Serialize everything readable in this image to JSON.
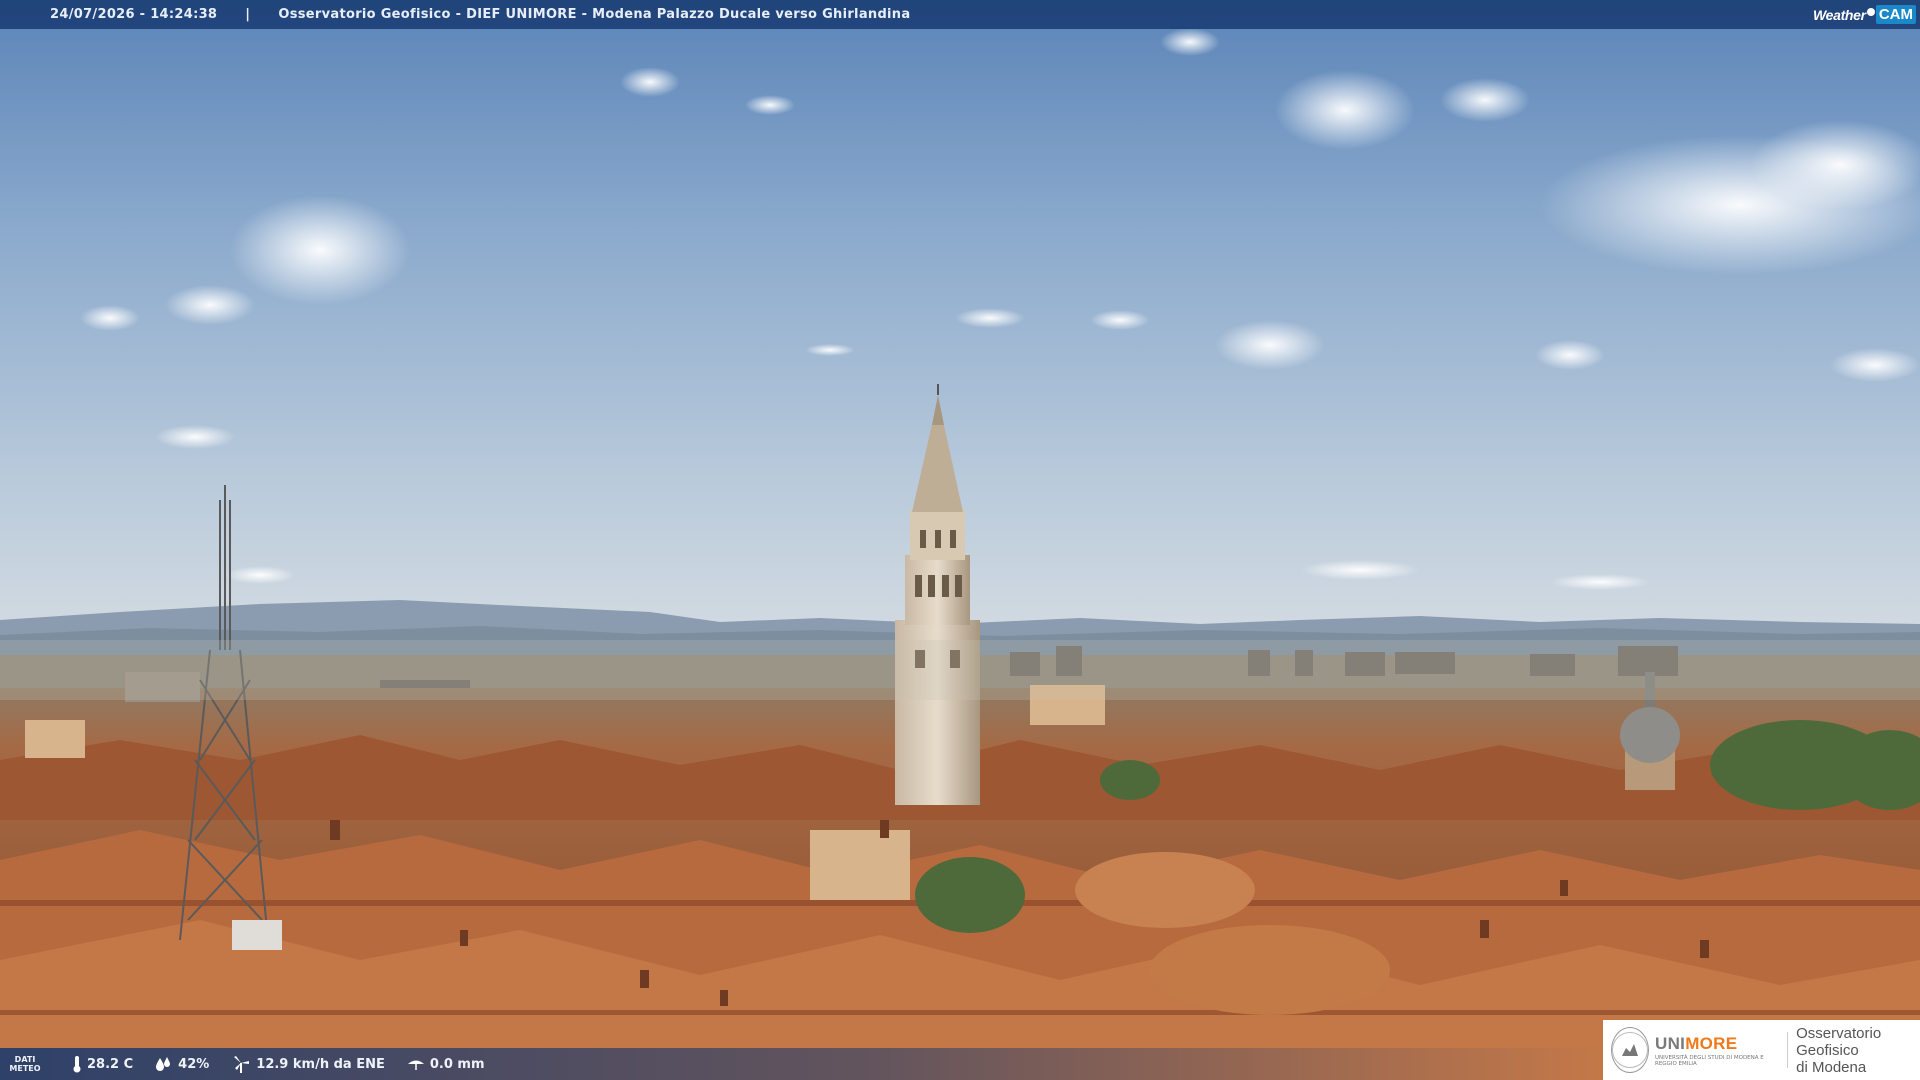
{
  "header": {
    "datetime": "24/07/2026 - 14:24:38",
    "separator": "|",
    "caption": "Osservatorio Geofisico - DIEF UNIMORE - Modena Palazzo Ducale verso Ghirlandina",
    "brand_weather": "Weather",
    "brand_cam": "CAM"
  },
  "weather": {
    "label": "DATI METEO",
    "temperature": "28.2 C",
    "humidity": "42%",
    "wind": "12.9 km/h da ENE",
    "rain": "0.0 mm"
  },
  "logo": {
    "unimore_a": "UNI",
    "unimore_b": "MORE",
    "unimore_sub": "UNIVERSITÀ DEGLI STUDI DI MODENA E REGGIO EMILIA",
    "observatory_line1": "Osservatorio Geofisico",
    "observatory_line2": "di Modena"
  },
  "colors": {
    "bar_blue": "#14376e",
    "cam_blue": "#1a88c9",
    "unimore_orange": "#f07a1a",
    "roof_terracotta": "#b5653a",
    "sky_top": "#5d86b8"
  }
}
